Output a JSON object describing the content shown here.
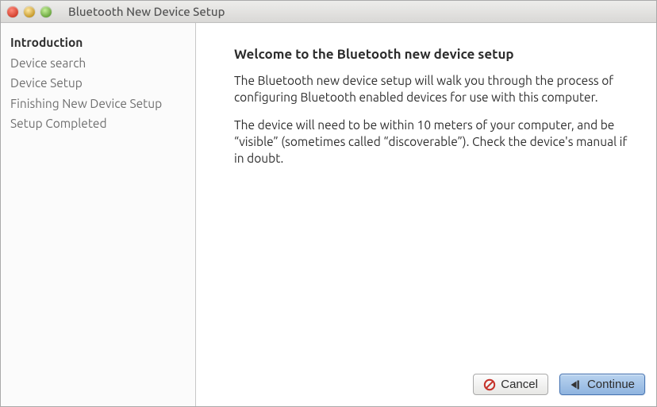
{
  "window": {
    "title": "Bluetooth New Device Setup"
  },
  "sidebar": {
    "items": [
      {
        "label": "Introduction",
        "active": true
      },
      {
        "label": "Device search",
        "active": false
      },
      {
        "label": "Device Setup",
        "active": false
      },
      {
        "label": "Finishing New Device Setup",
        "active": false
      },
      {
        "label": "Setup Completed",
        "active": false
      }
    ]
  },
  "content": {
    "heading": "Welcome to the Bluetooth new device setup",
    "paragraphs": [
      "The Bluetooth new device setup will walk you through the process of configuring Bluetooth enabled devices for use with this computer.",
      "The device will need to be within 10 meters of your computer, and be “visible” (sometimes called “discoverable”). Check the device's manual if in doubt."
    ]
  },
  "footer": {
    "cancel": "Cancel",
    "continue": "Continue"
  }
}
